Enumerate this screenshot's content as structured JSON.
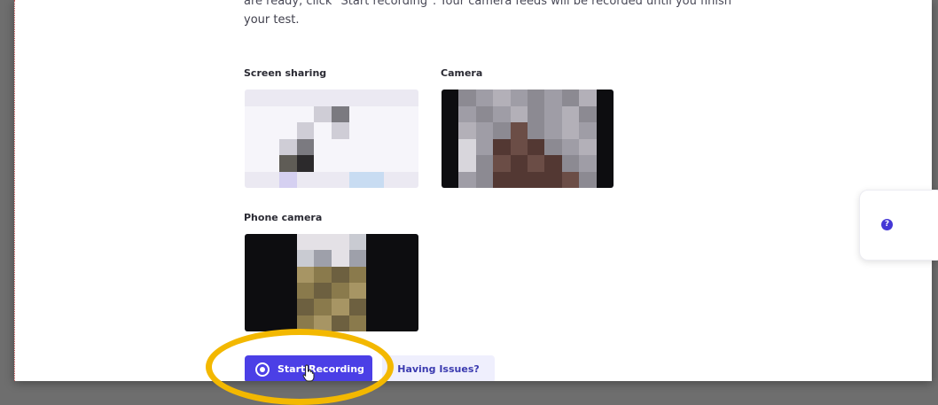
{
  "instructions": {
    "line1": "are ready, click \"Start recording\". Your camera feeds will be recorded until you finish",
    "line2": "your test."
  },
  "previews": {
    "screen_sharing_label": "Screen sharing",
    "camera_label": "Camera",
    "phone_camera_label": "Phone camera"
  },
  "actions": {
    "start_recording": "Start Recording",
    "having_issues": "Having Issues?"
  },
  "help": {
    "icon": "question-icon",
    "glyph": "?"
  },
  "colors": {
    "primary": "#4b3fe6",
    "secondary_bg": "#efeffd",
    "highlight": "#f3b800",
    "help_icon": "#4437d6"
  }
}
